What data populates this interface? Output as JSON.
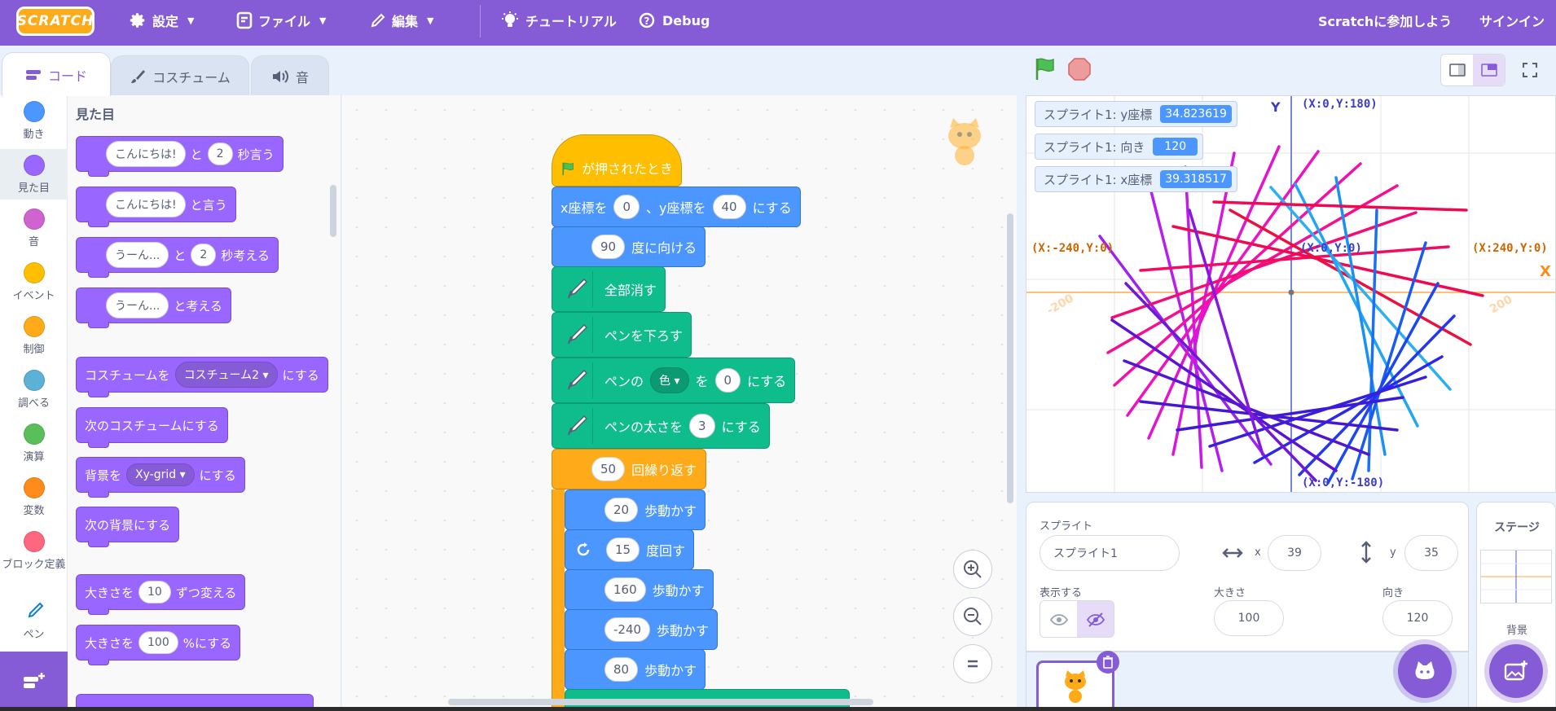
{
  "menubar": {
    "logo": "SCRATCH",
    "settings": "設定",
    "file": "ファイル",
    "edit": "編集",
    "tutorial": "チュートリアル",
    "debug": "Debug",
    "join": "Scratchに参加しよう",
    "signin": "サインイン"
  },
  "tabs": {
    "code": "コード",
    "costume": "コスチューム",
    "sound": "音"
  },
  "categories": [
    {
      "label": "動き",
      "color": "#4c97ff"
    },
    {
      "label": "見た目",
      "color": "#9966ff"
    },
    {
      "label": "音",
      "color": "#cf63cf"
    },
    {
      "label": "イベント",
      "color": "#ffbf00"
    },
    {
      "label": "制御",
      "color": "#ffab19"
    },
    {
      "label": "調べる",
      "color": "#5cb1d6"
    },
    {
      "label": "演算",
      "color": "#59c059"
    },
    {
      "label": "変数",
      "color": "#ff8c1a"
    },
    {
      "label": "ブロック定義",
      "color": "#ff6680"
    },
    {
      "label": "ペン",
      "color": "#0fbd8c"
    }
  ],
  "palette": {
    "title": "見た目",
    "b1": {
      "a": "こんにちは!",
      "b": "と",
      "c": "2",
      "d": "秒言う"
    },
    "b2": {
      "a": "こんにちは!",
      "b": "と言う"
    },
    "b3": {
      "a": "うーん...",
      "b": "と",
      "c": "2",
      "d": "秒考える"
    },
    "b4": {
      "a": "うーん...",
      "b": "と考える"
    },
    "b5": {
      "a": "コスチュームを",
      "b": "コスチューム2",
      "c": "にする"
    },
    "b6": {
      "a": "次のコスチュームにする"
    },
    "b7": {
      "a": "背景を",
      "b": "Xy-grid",
      "c": "にする"
    },
    "b8": {
      "a": "次の背景にする"
    },
    "b9": {
      "a": "大きさを",
      "b": "10",
      "c": "ずつ変える"
    },
    "b10": {
      "a": "大きさを",
      "b": "100",
      "c": "%にする"
    }
  },
  "script": {
    "hat": "が押されたとき",
    "goto": {
      "a": "x座標を",
      "x": "0",
      "b": "、y座標を",
      "y": "40",
      "c": "にする"
    },
    "point": {
      "v": "90",
      "a": "度に向ける"
    },
    "clear": "全部消す",
    "pendown": "ペンを下ろす",
    "setcolor": {
      "a": "ペンの",
      "b": "色",
      "c": "を",
      "v": "0",
      "d": "にする"
    },
    "setsize": {
      "a": "ペンの太さを",
      "v": "3",
      "b": "にする"
    },
    "repeat": {
      "v": "50",
      "a": "回繰り返す"
    },
    "move1": {
      "v": "20",
      "a": "歩動かす"
    },
    "turn": {
      "v": "15",
      "a": "度回す"
    },
    "move2": {
      "v": "160",
      "a": "歩動かす"
    },
    "move3": {
      "v": "-240",
      "a": "歩動かす"
    },
    "move4": {
      "v": "80",
      "a": "歩動かす"
    }
  },
  "monitors": [
    {
      "label": "スプライト1: y座標",
      "value": "34.823619"
    },
    {
      "label": "スプライト1: 向き",
      "value": "120"
    },
    {
      "label": "スプライト1: x座標",
      "value": "39.318517"
    }
  ],
  "stage_labels": {
    "top": "(X:0,Y:180)",
    "bottom": "(X:0,Y:-180)",
    "left": "(X:-240,Y:0)",
    "right": "(X:240,Y:0)",
    "center": "(X:0,Y:0)",
    "xaxis": "X",
    "yaxis": "Y",
    "t200": "200",
    "tm200": "-200"
  },
  "sprite_info": {
    "sprite_label": "スプライト",
    "name": "スプライト1",
    "x_label": "x",
    "x": "39",
    "y_label": "y",
    "y": "35",
    "show_label": "表示する",
    "size_label": "大きさ",
    "size": "100",
    "dir_label": "向き",
    "dir": "120"
  },
  "stage_panel": {
    "title": "ステージ",
    "bg_label": "背景"
  }
}
